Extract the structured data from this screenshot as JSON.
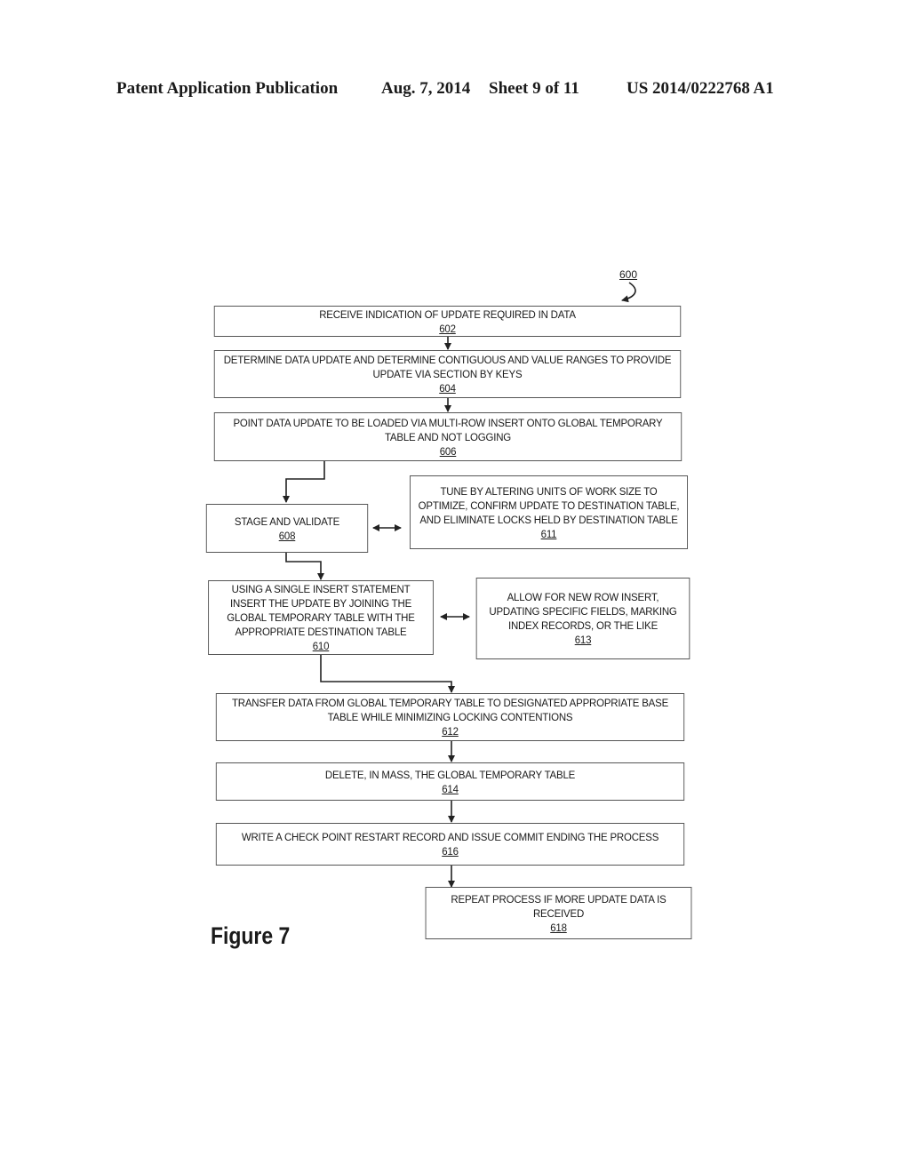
{
  "header": {
    "publication": "Patent Application Publication",
    "date": "Aug. 7, 2014",
    "sheet": "Sheet 9 of 11",
    "number": "US 2014/0222768 A1"
  },
  "diagram": {
    "ref": "600",
    "figure_label": "Figure 7",
    "steps": [
      {
        "id": "602",
        "text": "RECEIVE INDICATION OF UPDATE REQUIRED IN DATA"
      },
      {
        "id": "604",
        "text": "DETERMINE DATA UPDATE AND DETERMINE CONTIGUOUS AND VALUE RANGES TO PROVIDE UPDATE VIA SECTION BY KEYS"
      },
      {
        "id": "606",
        "text": "POINT DATA UPDATE TO BE LOADED VIA MULTI-ROW INSERT ONTO GLOBAL TEMPORARY TABLE AND NOT LOGGING"
      },
      {
        "id": "608",
        "text": "STAGE AND VALIDATE"
      },
      {
        "id": "611",
        "text": "TUNE BY ALTERING UNITS OF WORK SIZE TO OPTIMIZE, CONFIRM UPDATE TO DESTINATION TABLE, AND ELIMINATE LOCKS HELD BY DESTINATION TABLE"
      },
      {
        "id": "610",
        "text": "USING A SINGLE INSERT STATEMENT INSERT THE UPDATE BY JOINING THE GLOBAL TEMPORARY TABLE WITH THE APPROPRIATE DESTINATION TABLE"
      },
      {
        "id": "613",
        "text": "ALLOW FOR NEW ROW INSERT, UPDATING SPECIFIC FIELDS, MARKING INDEX RECORDS, OR THE LIKE"
      },
      {
        "id": "612",
        "text": "TRANSFER DATA FROM GLOBAL TEMPORARY TABLE TO DESIGNATED APPROPRIATE BASE TABLE WHILE MINIMIZING LOCKING CONTENTIONS"
      },
      {
        "id": "614",
        "text": "DELETE, IN MASS, THE GLOBAL TEMPORARY TABLE"
      },
      {
        "id": "616",
        "text": "WRITE A CHECK POINT RESTART RECORD AND ISSUE COMMIT ENDING THE PROCESS"
      },
      {
        "id": "618",
        "text": "REPEAT PROCESS IF MORE UPDATE DATA IS RECEIVED"
      }
    ],
    "connections": [
      {
        "from": "602",
        "to": "604",
        "type": "arrow"
      },
      {
        "from": "604",
        "to": "606",
        "type": "arrow"
      },
      {
        "from": "606",
        "to": "608",
        "type": "arrow"
      },
      {
        "from": "608",
        "to": "611",
        "type": "bidirectional"
      },
      {
        "from": "608",
        "to": "610",
        "type": "arrow"
      },
      {
        "from": "610",
        "to": "613",
        "type": "bidirectional"
      },
      {
        "from": "610",
        "to": "612",
        "type": "arrow"
      },
      {
        "from": "612",
        "to": "614",
        "type": "arrow"
      },
      {
        "from": "614",
        "to": "616",
        "type": "arrow"
      },
      {
        "from": "616",
        "to": "618",
        "type": "arrow"
      }
    ]
  }
}
